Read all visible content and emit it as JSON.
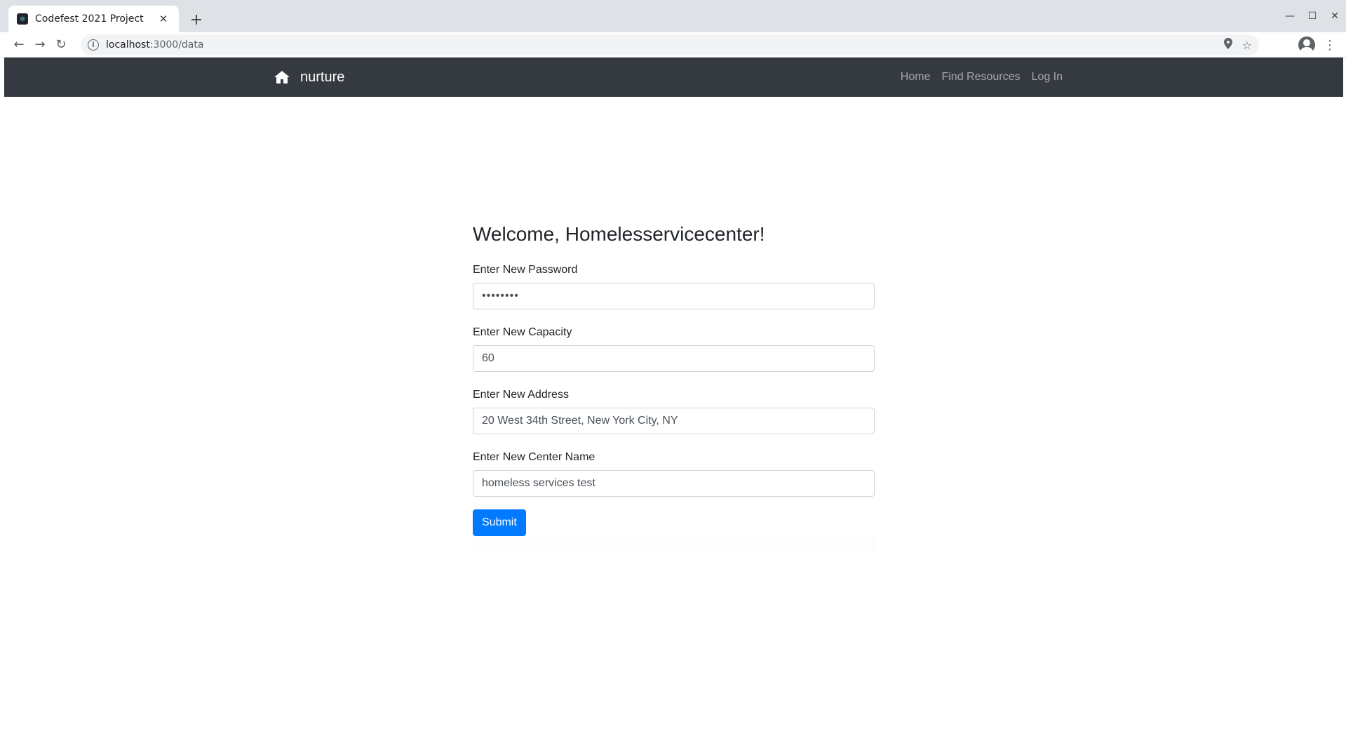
{
  "browser": {
    "tab_title": "Codefest 2021 Project",
    "tab_favicon": "react-icon",
    "url_host": "localhost",
    "url_path": ":3000/data",
    "colors": {
      "tabstrip": "#dee1e6",
      "omnibox": "#f1f3f4"
    }
  },
  "navbar": {
    "brand": "nurture",
    "brand_icon": "home-icon",
    "links": [
      "Home",
      "Find Resources",
      "Log In"
    ],
    "colors": {
      "background": "#343a40",
      "link": "rgba(255,255,255,0.55)"
    }
  },
  "form": {
    "welcome": "Welcome, Homelesservicecenter!",
    "fields": [
      {
        "label": "Enter New Password",
        "value": "••••••••",
        "type": "password"
      },
      {
        "label": "Enter New Capacity",
        "value": "60",
        "type": "text"
      },
      {
        "label": "Enter New Address",
        "value": "20 West 34th Street, New York City, NY",
        "type": "text"
      },
      {
        "label": "Enter New Center Name",
        "value": "homeless services test",
        "type": "text"
      }
    ],
    "submit_label": "Submit",
    "colors": {
      "submit": "#007bff"
    }
  }
}
